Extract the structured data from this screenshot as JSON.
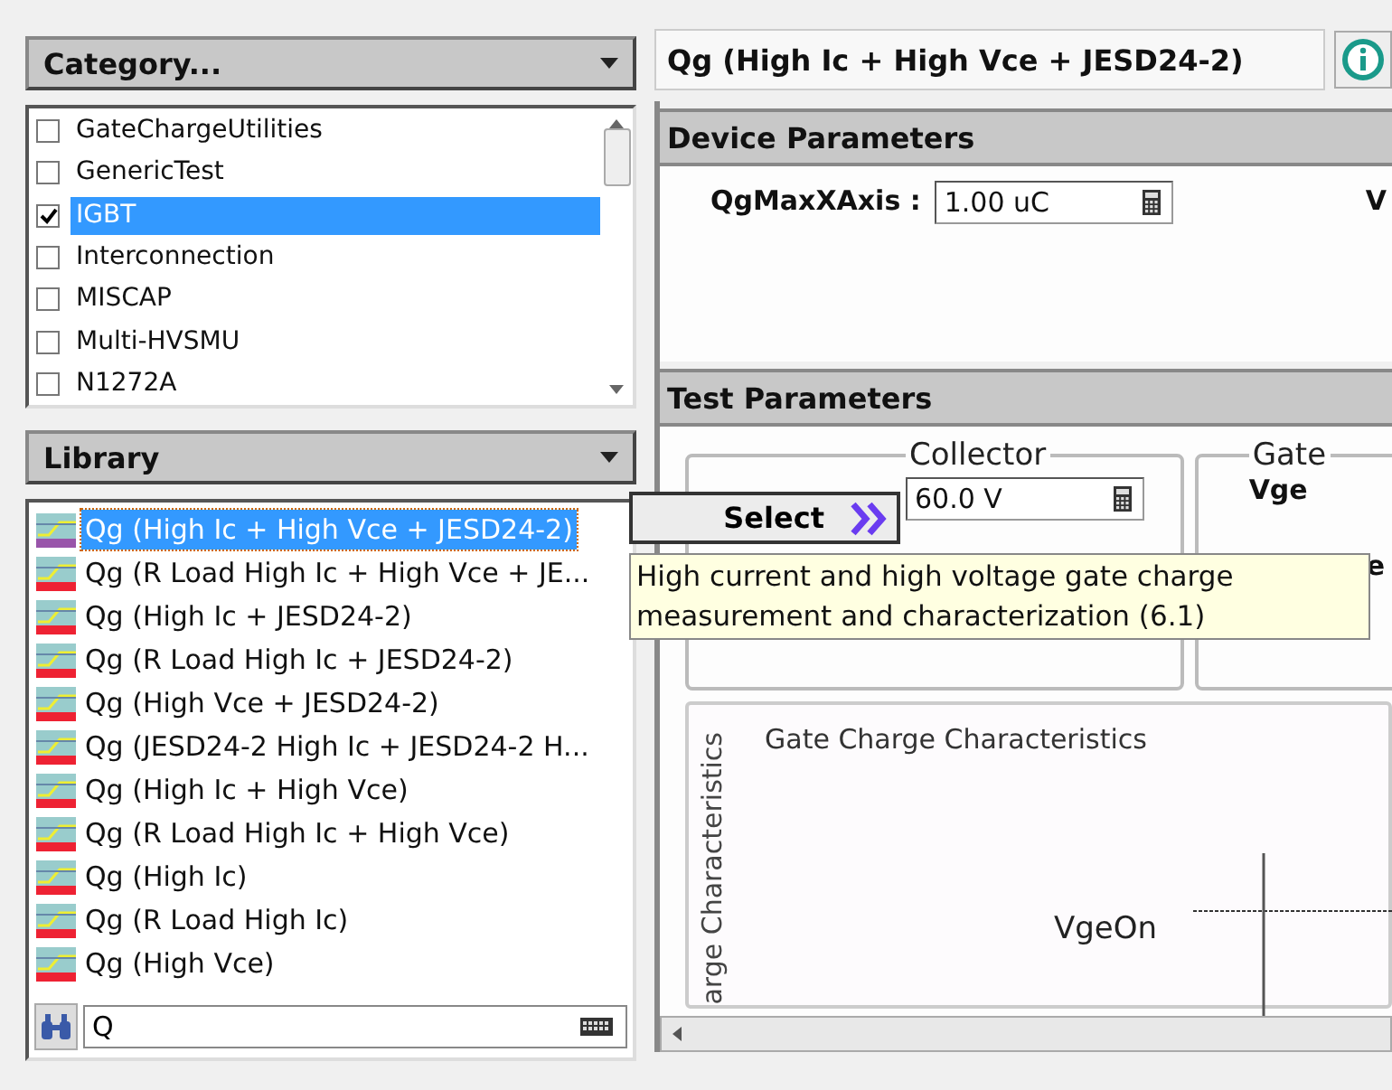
{
  "category": {
    "title": "Category...",
    "items": [
      {
        "label": "GateChargeUtilities",
        "checked": false,
        "selected": false
      },
      {
        "label": "GenericTest",
        "checked": false,
        "selected": false
      },
      {
        "label": "IGBT",
        "checked": true,
        "selected": true
      },
      {
        "label": "Interconnection",
        "checked": false,
        "selected": false
      },
      {
        "label": "MISCAP",
        "checked": false,
        "selected": false
      },
      {
        "label": "Multi-HVSMU",
        "checked": false,
        "selected": false
      },
      {
        "label": "N1272A",
        "checked": false,
        "selected": false
      }
    ]
  },
  "library": {
    "title": "Library",
    "items": [
      {
        "label": "Qg (High Ic + High Vce + JESD24-2)",
        "selected": true
      },
      {
        "label": "Qg (R Load High Ic + High Vce + JE...",
        "selected": false
      },
      {
        "label": "Qg (High Ic + JESD24-2)",
        "selected": false
      },
      {
        "label": "Qg (R Load High Ic + JESD24-2)",
        "selected": false
      },
      {
        "label": "Qg (High Vce + JESD24-2)",
        "selected": false
      },
      {
        "label": "Qg (JESD24-2 High Ic + JESD24-2 H...",
        "selected": false
      },
      {
        "label": "Qg (High Ic + High Vce)",
        "selected": false
      },
      {
        "label": "Qg (R Load High Ic + High Vce)",
        "selected": false
      },
      {
        "label": "Qg (High Ic)",
        "selected": false
      },
      {
        "label": "Qg (R Load High Ic)",
        "selected": false
      },
      {
        "label": "Qg (High Vce)",
        "selected": false
      }
    ],
    "search": {
      "value": "Q"
    }
  },
  "test_title": "Qg (High Ic + High Vce + JESD24-2)",
  "device_parameters": {
    "title": "Device Parameters",
    "fields": [
      {
        "label": "QgMaxXAxis :",
        "value": "1.00 uC"
      }
    ],
    "cut_label": "V"
  },
  "test_parameters": {
    "title": "Test Parameters",
    "collector": {
      "title": "Collector",
      "value": "60.0 V"
    },
    "gate": {
      "title": "Gate",
      "labels": [
        "Vge",
        "e"
      ]
    },
    "chart": {
      "title": "Gate Charge Characteristics",
      "ylabel": "arge Characteristics",
      "marker_label": "VgeOn"
    }
  },
  "select_button": "Select",
  "tooltip": "High current and high voltage gate charge measurement and characterization (6.1)"
}
